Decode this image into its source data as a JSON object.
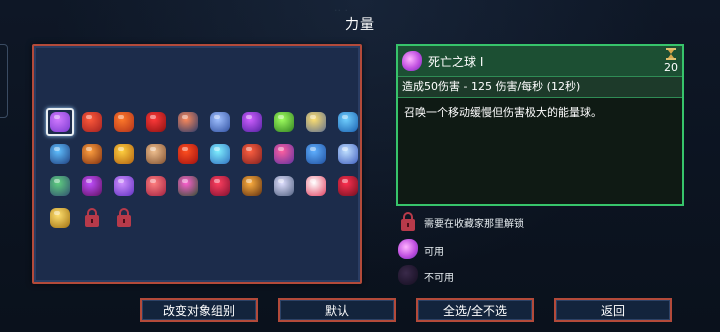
{
  "page": {
    "title": "力量"
  },
  "colors": {
    "panel_border": "#b34a3a",
    "detail_border": "#37c46b",
    "background": "#0b1320",
    "lock": "#b73a4a"
  },
  "grid": {
    "selected_index": 0,
    "slots": [
      {
        "icon": "death-orb-icon",
        "color": "#d27aff",
        "color2": "#7a3bd0"
      },
      {
        "icon": "flame-dash-icon",
        "color": "#ff5a3a",
        "color2": "#a02020"
      },
      {
        "icon": "fire-spikes-icon",
        "color": "#ff7a2a",
        "color2": "#b0301a"
      },
      {
        "icon": "blood-drop-icon",
        "color": "#ff3a3a",
        "color2": "#8a1010"
      },
      {
        "icon": "dagger-icon",
        "color": "#ff8a5a",
        "color2": "#2a3a6a"
      },
      {
        "icon": "void-ring-icon",
        "color": "#a0c0ff",
        "color2": "#3050a0"
      },
      {
        "icon": "shadow-slash-icon",
        "color": "#d060ff",
        "color2": "#5020a0"
      },
      {
        "icon": "poison-cloud-icon",
        "color": "#a0ff60",
        "color2": "#308020"
      },
      {
        "icon": "spirit-wheel-icon",
        "color": "#ffe070",
        "color2": "#607090"
      },
      {
        "icon": "ice-vortex-icon",
        "color": "#70d0ff",
        "color2": "#1a60b0"
      },
      {
        "icon": "chain-hook-icon",
        "color": "#60c0ff",
        "color2": "#204080"
      },
      {
        "icon": "bull-head-icon",
        "color": "#ffa040",
        "color2": "#803010"
      },
      {
        "icon": "golden-sword-icon",
        "color": "#ffd040",
        "color2": "#b06010"
      },
      {
        "icon": "cube-head-icon",
        "color": "#f0c090",
        "color2": "#805030"
      },
      {
        "icon": "fire-wave-icon",
        "color": "#ff5020",
        "color2": "#a01010"
      },
      {
        "icon": "ice-bolt-icon",
        "color": "#80f0ff",
        "color2": "#3070c0"
      },
      {
        "icon": "bomb-icon",
        "color": "#ff6040",
        "color2": "#802020"
      },
      {
        "icon": "eye-beast-icon",
        "color": "#ff60a0",
        "color2": "#6030a0"
      },
      {
        "icon": "frost-cluster-icon",
        "color": "#60b0ff",
        "color2": "#2050a0"
      },
      {
        "icon": "lightning-fork-icon",
        "color": "#c0e0ff",
        "color2": "#4060c0"
      },
      {
        "icon": "sickle-icon",
        "color": "#60d080",
        "color2": "#305070"
      },
      {
        "icon": "shadow-cat-icon",
        "color": "#c050ff",
        "color2": "#601060"
      },
      {
        "icon": "purple-egg-icon",
        "color": "#d090ff",
        "color2": "#6030c0"
      },
      {
        "icon": "potion-flask-icon",
        "color": "#ff8080",
        "color2": "#a02040"
      },
      {
        "icon": "totem-icon",
        "color": "#ff60d0",
        "color2": "#305030"
      },
      {
        "icon": "red-cross-orb-icon",
        "color": "#ff4060",
        "color2": "#801030"
      },
      {
        "icon": "fire-lantern-icon",
        "color": "#ffb040",
        "color2": "#603010"
      },
      {
        "icon": "spark-wand-icon",
        "color": "#e0e0ff",
        "color2": "#506080"
      },
      {
        "icon": "fox-mask-icon",
        "color": "#ffffff",
        "color2": "#e04060"
      },
      {
        "icon": "crimson-bat-icon",
        "color": "#ff3050",
        "color2": "#701020"
      },
      {
        "icon": "golden-bell-icon",
        "color": "#ffe070",
        "color2": "#a07010"
      },
      {
        "icon": "lock-icon",
        "locked": true
      },
      {
        "icon": "lock-icon",
        "locked": true
      }
    ]
  },
  "detail": {
    "name": "死亡之球 I",
    "cooldown": "20",
    "stats": "造成50伤害 - 125 伤害/每秒 (12秒)",
    "description": "召唤一个移动缓慢但伤害极大的能量球。"
  },
  "legend": {
    "locked": "需要在收藏家那里解锁",
    "available": "可用",
    "unavailable": "不可用"
  },
  "buttons": {
    "change_group": "改变对象组别",
    "default": "默认",
    "select_all": "全选/全不选",
    "back": "返回"
  }
}
